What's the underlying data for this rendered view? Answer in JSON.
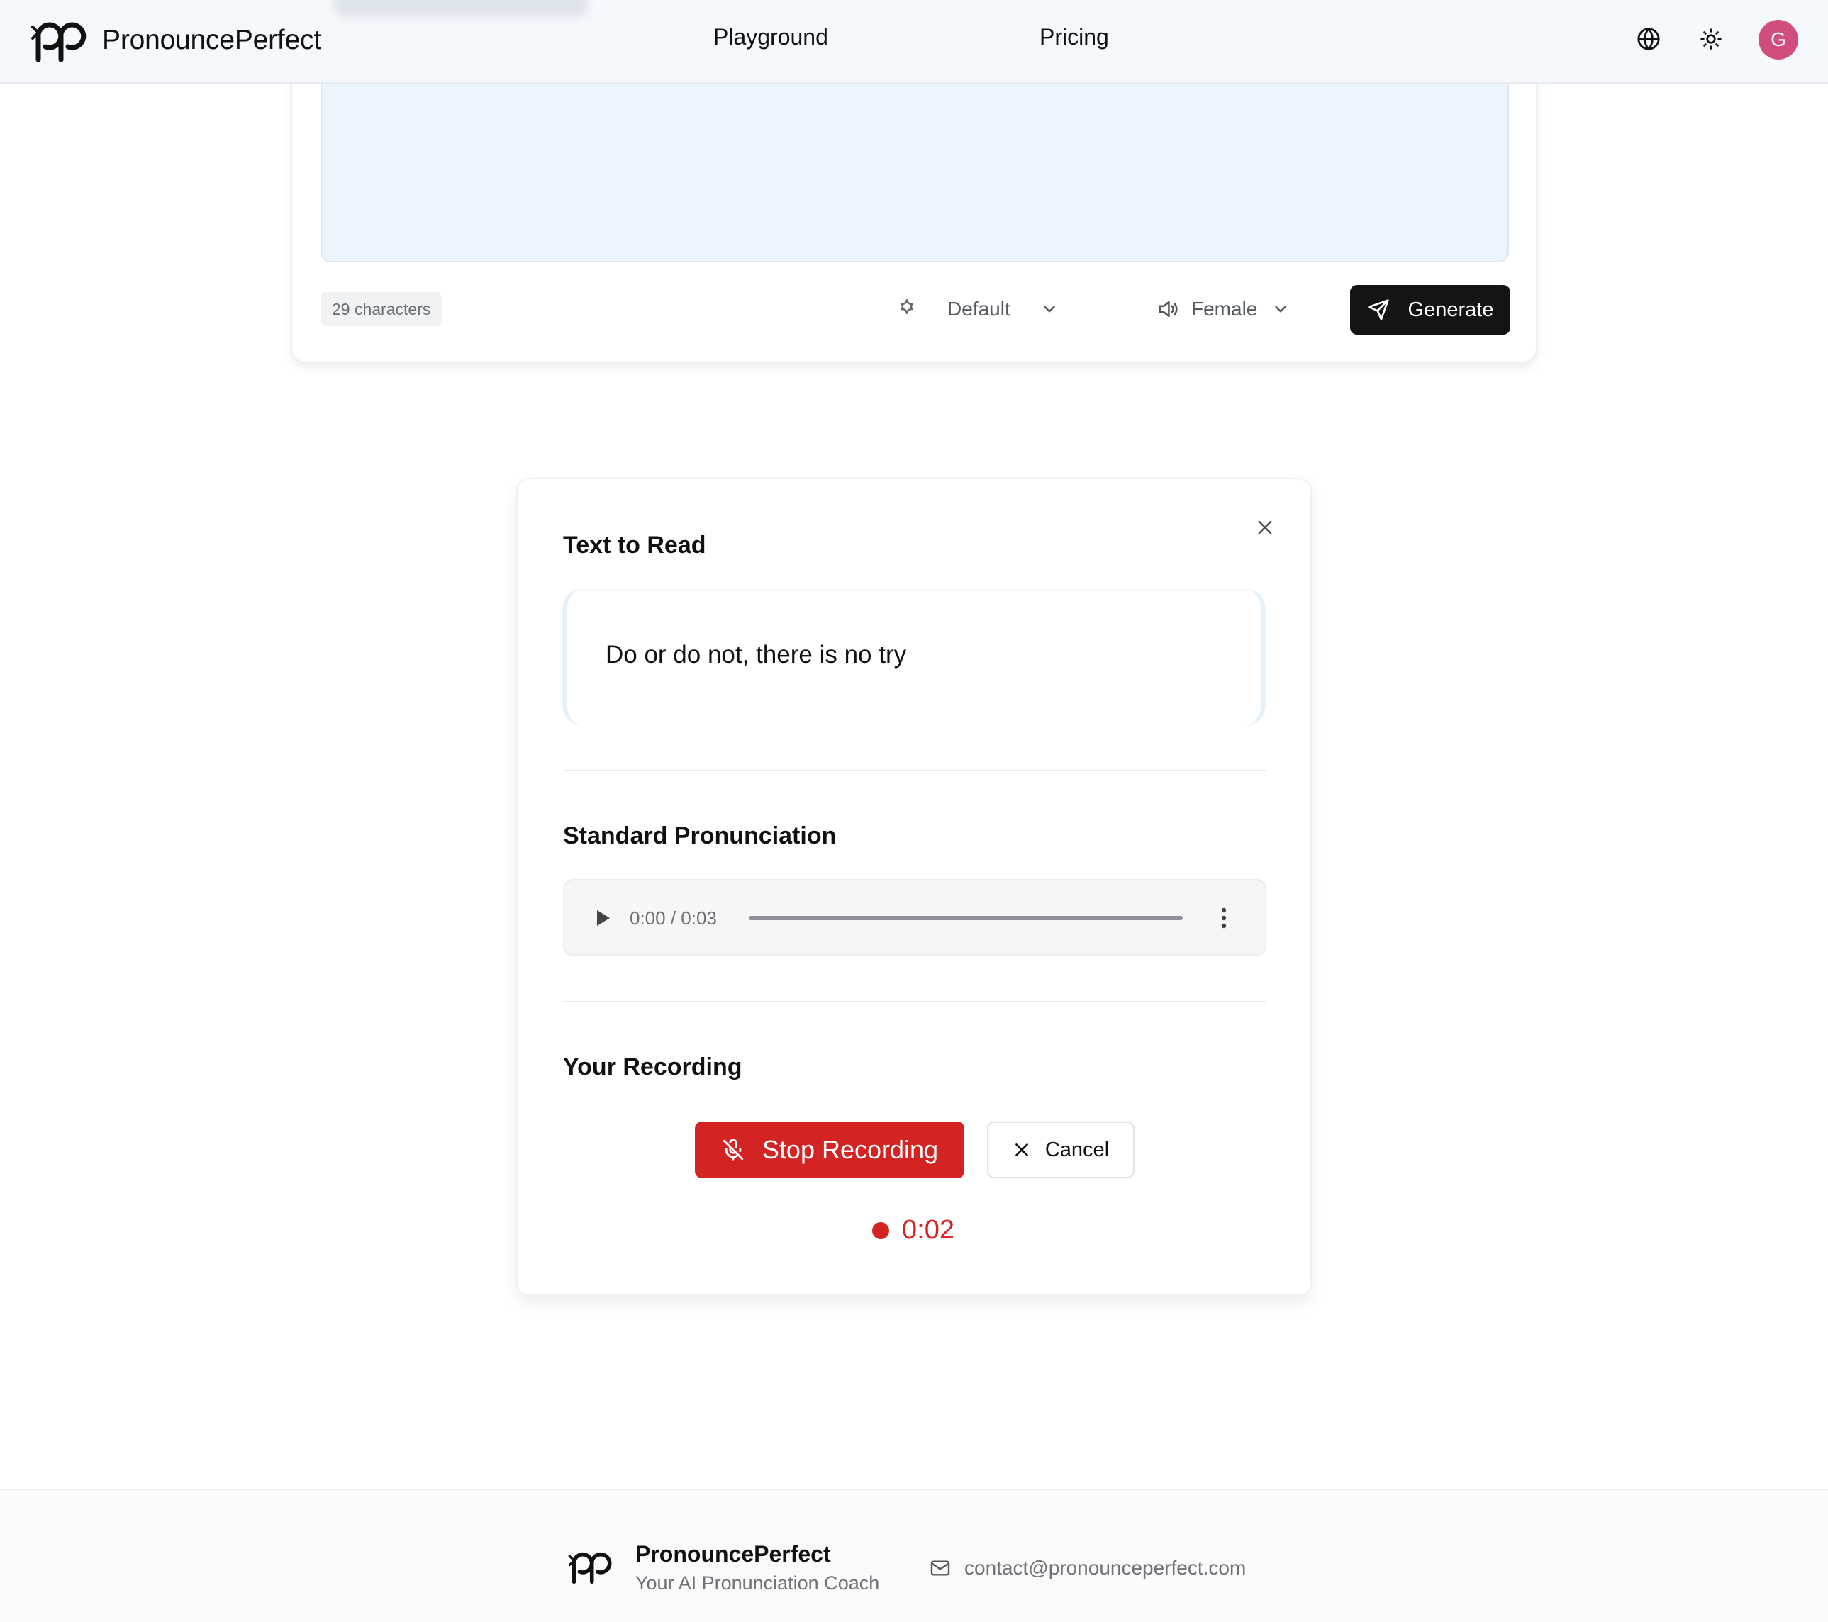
{
  "header": {
    "brand_name": "PronouncePerfect",
    "nav": {
      "playground": "Playground",
      "pricing": "Pricing"
    },
    "avatar_initial": "G",
    "avatar_color": "#d14d7f"
  },
  "editor": {
    "char_count": "29 characters",
    "model_select": "Default",
    "voice_select": "Female",
    "generate_label": "Generate"
  },
  "practice_modal": {
    "text_to_read_title": "Text to Read",
    "text_to_read": "Do or do not, there is no try",
    "standard_title": "Standard Pronunciation",
    "audio": {
      "time": "0:00 / 0:03",
      "progress": 0
    },
    "recording_title": "Your Recording",
    "stop_label": "Stop Recording",
    "cancel_label": "Cancel",
    "elapsed": "0:02",
    "accent_red": "#d42323"
  },
  "footer": {
    "brand_name": "PronouncePerfect",
    "tagline": "Your AI Pronunciation Coach",
    "email": "contact@pronounceperfect.com"
  }
}
